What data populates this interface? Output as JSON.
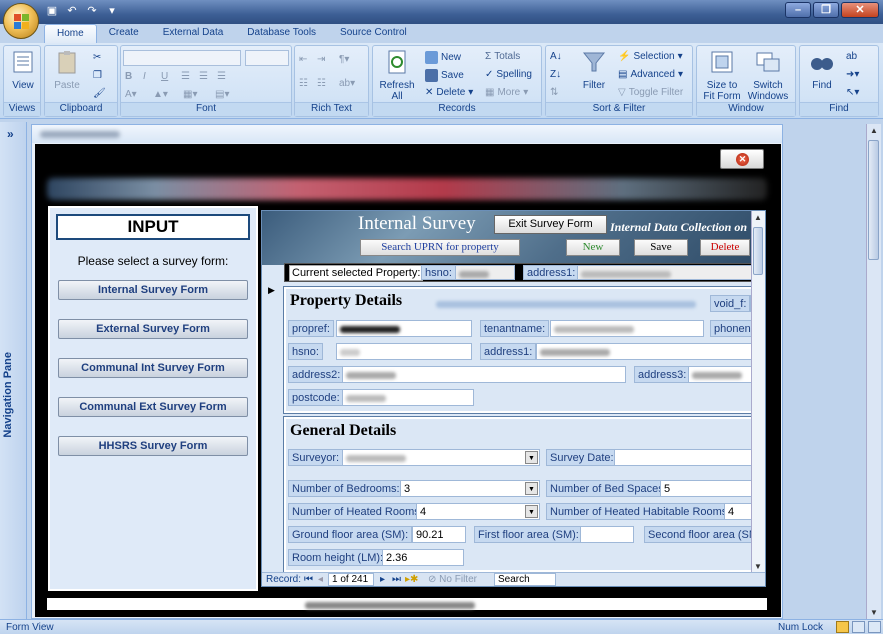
{
  "app": {
    "tabs": [
      "Home",
      "Create",
      "External Data",
      "Database Tools",
      "Source Control"
    ],
    "active_tab": "Home"
  },
  "ribbon": {
    "views": {
      "view_label": "View",
      "group": "Views"
    },
    "clipboard": {
      "paste_label": "Paste",
      "group": "Clipboard"
    },
    "font": {
      "group": "Font"
    },
    "rich_text": {
      "group": "Rich Text"
    },
    "records": {
      "refresh_label": "Refresh",
      "refresh_sub": "All",
      "new": "New",
      "save": "Save",
      "delete": "Delete",
      "totals": "Totals",
      "spelling": "Spelling",
      "more": "More",
      "group": "Records"
    },
    "sort_filter": {
      "filter_label": "Filter",
      "selection": "Selection",
      "advanced": "Advanced",
      "toggle_filter": "Toggle Filter",
      "group": "Sort & Filter"
    },
    "window": {
      "size_label": "Size to",
      "size_sub": "Fit Form",
      "switch_label": "Switch",
      "switch_sub": "Windows",
      "group": "Window"
    },
    "find": {
      "find_label": "Find",
      "group": "Find"
    }
  },
  "nav_pane": {
    "label": "Navigation Pane"
  },
  "input_panel": {
    "title": "INPUT",
    "prompt": "Please select a survey form:",
    "buttons": [
      "Internal Survey Form",
      "External Survey Form",
      "Communal Int Survey Form",
      "Communal Ext Survey Form",
      "HHSRS Survey Form"
    ]
  },
  "survey": {
    "title": "Internal Survey",
    "subtitle": "Internal Data Collection on",
    "exit_button": "Exit Survey Form",
    "search_button": "Search UPRN for property",
    "new_button": "New",
    "save_button": "Save",
    "delete_button": "Delete",
    "current_property_label": "Current selected Property:",
    "cp_hsno_label": "hsno:",
    "cp_address1_label": "address1:",
    "property_details": {
      "heading": "Property Details",
      "void_label": "void_f:",
      "propref_label": "propref:",
      "tenantname_label": "tenantname:",
      "phonenum_label": "phonenum",
      "hsno_label": "hsno:",
      "address1_label": "address1:",
      "address2_label": "address2:",
      "address3_label": "address3:",
      "postcode_label": "postcode:"
    },
    "general_details": {
      "heading": "General Details",
      "surveyor_label": "Surveyor:",
      "survey_date_label": "Survey Date:",
      "bedrooms_label": "Number of Bedrooms:",
      "bedrooms_value": "3",
      "bedspaces_label": "Number of Bed Spaces:",
      "bedspaces_value": "5",
      "heated_rooms_label": "Number of Heated Rooms:",
      "heated_rooms_value": "4",
      "heated_habitable_label": "Number of Heated Habitable Rooms:",
      "heated_habitable_value": "4",
      "ground_area_label": "Ground floor area (SM):",
      "ground_area_value": "90.21",
      "first_area_label": "First floor area (SM):",
      "second_area_label": "Second floor area (SM):",
      "room_height_label": "Room height (LM):",
      "room_height_value": "2.36"
    },
    "record_nav": {
      "label": "Record:",
      "position": "1 of 241",
      "no_filter": "No Filter",
      "search": "Search"
    }
  },
  "status_bar": {
    "left": "Form View",
    "right": "Num Lock"
  }
}
